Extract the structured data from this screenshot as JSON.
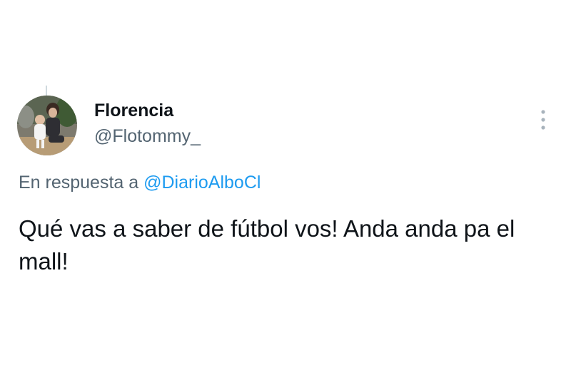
{
  "tweet": {
    "author": {
      "display_name": "Florencia",
      "handle": "@Flotommy_",
      "avatar_icon": "profile-photo"
    },
    "reply_context": {
      "prefix": "En respuesta a",
      "mention": "@DiarioAlboCl"
    },
    "text": "Qué vas a saber de fútbol vos! Anda anda pa el mall!",
    "more_icon": "more-vertical-icon"
  },
  "colors": {
    "text_primary": "#0f1419",
    "text_secondary": "#536471",
    "link": "#1d9bf0",
    "background": "#ffffff"
  }
}
